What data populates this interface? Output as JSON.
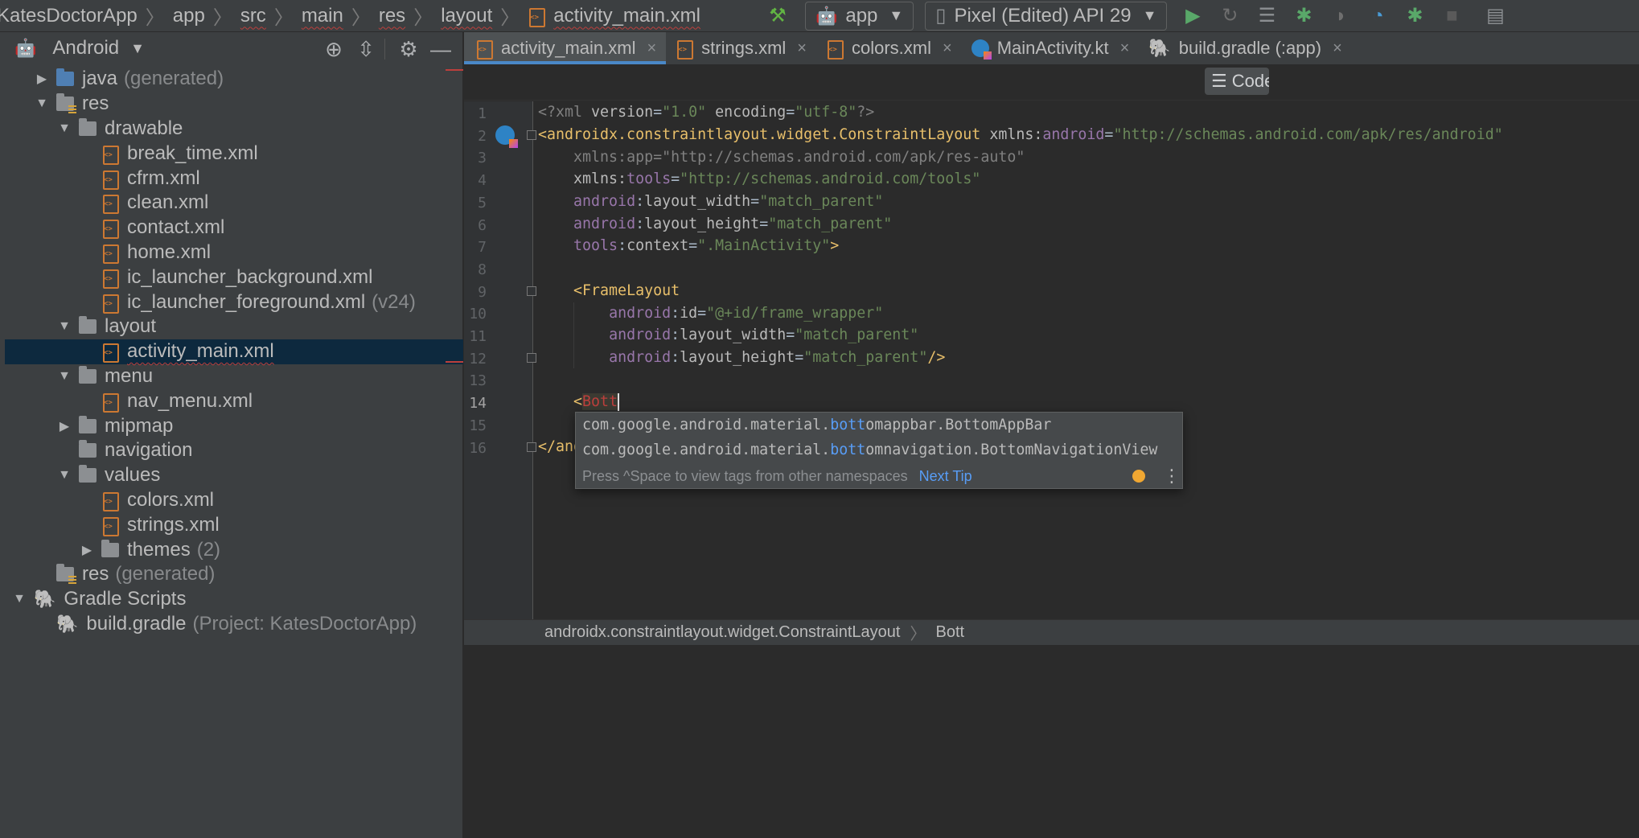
{
  "breadcrumb": {
    "items": [
      "KatesDoctorApp",
      "app",
      "src",
      "main",
      "res",
      "layout",
      "activity_main.xml"
    ]
  },
  "toolbar": {
    "run_config": "app",
    "device": "Pixel (Edited) API 29",
    "icons": [
      "hammer-icon",
      "run-icon",
      "rerun-icon",
      "coverage-icon",
      "debug-icon",
      "profile-icon",
      "speed-icon",
      "attach-debugger-icon",
      "stop-icon",
      "project-structure-icon"
    ]
  },
  "project_panel": {
    "view": "Android",
    "tree": [
      {
        "label": "java",
        "hint": "(generated)",
        "depth": 1,
        "kind": "java",
        "arrow": "collapsed"
      },
      {
        "label": "res",
        "hint": "",
        "depth": 1,
        "kind": "res",
        "arrow": "expanded"
      },
      {
        "label": "drawable",
        "hint": "",
        "depth": 2,
        "kind": "folder",
        "arrow": "expanded"
      },
      {
        "label": "break_time.xml",
        "hint": "",
        "depth": 3,
        "kind": "xml",
        "arrow": "none"
      },
      {
        "label": "cfrm.xml",
        "hint": "",
        "depth": 3,
        "kind": "xml",
        "arrow": "none"
      },
      {
        "label": "clean.xml",
        "hint": "",
        "depth": 3,
        "kind": "xml",
        "arrow": "none"
      },
      {
        "label": "contact.xml",
        "hint": "",
        "depth": 3,
        "kind": "xml",
        "arrow": "none"
      },
      {
        "label": "home.xml",
        "hint": "",
        "depth": 3,
        "kind": "xml",
        "arrow": "none"
      },
      {
        "label": "ic_launcher_background.xml",
        "hint": "",
        "depth": 3,
        "kind": "xml",
        "arrow": "none"
      },
      {
        "label": "ic_launcher_foreground.xml",
        "hint": "(v24)",
        "depth": 3,
        "kind": "xml",
        "arrow": "none"
      },
      {
        "label": "layout",
        "hint": "",
        "depth": 2,
        "kind": "folder",
        "arrow": "expanded"
      },
      {
        "label": "activity_main.xml",
        "hint": "",
        "depth": 3,
        "kind": "xml",
        "arrow": "none",
        "selected": true
      },
      {
        "label": "menu",
        "hint": "",
        "depth": 2,
        "kind": "folder",
        "arrow": "expanded"
      },
      {
        "label": "nav_menu.xml",
        "hint": "",
        "depth": 3,
        "kind": "xml",
        "arrow": "none"
      },
      {
        "label": "mipmap",
        "hint": "",
        "depth": 2,
        "kind": "folder",
        "arrow": "collapsed"
      },
      {
        "label": "navigation",
        "hint": "",
        "depth": 2,
        "kind": "folder",
        "arrow": "none"
      },
      {
        "label": "values",
        "hint": "",
        "depth": 2,
        "kind": "folder",
        "arrow": "expanded"
      },
      {
        "label": "colors.xml",
        "hint": "",
        "depth": 3,
        "kind": "xml",
        "arrow": "none"
      },
      {
        "label": "strings.xml",
        "hint": "",
        "depth": 3,
        "kind": "xml",
        "arrow": "none"
      },
      {
        "label": "themes",
        "hint": "(2)",
        "depth": 3,
        "kind": "folder",
        "arrow": "collapsed"
      },
      {
        "label": "res",
        "hint": "(generated)",
        "depth": 1,
        "kind": "res",
        "arrow": "none"
      },
      {
        "label": "Gradle Scripts",
        "hint": "",
        "depth": 0,
        "kind": "gradle",
        "arrow": "expanded"
      },
      {
        "label": "build.gradle",
        "hint": "(Project: KatesDoctorApp)",
        "depth": 1,
        "kind": "gradle",
        "arrow": "none"
      }
    ]
  },
  "tabs": [
    {
      "label": "activity_main.xml",
      "icon": "xml-icon",
      "active": true
    },
    {
      "label": "strings.xml",
      "icon": "xml-icon",
      "active": false
    },
    {
      "label": "colors.xml",
      "icon": "xml-icon",
      "active": false
    },
    {
      "label": "MainActivity.kt",
      "icon": "kotlin-icon",
      "active": false
    },
    {
      "label": "build.gradle (:app)",
      "icon": "gradle-icon",
      "active": false
    }
  ],
  "editor": {
    "view_mode_button": "Code",
    "current_line": 14,
    "line_numbers": [
      "1",
      "2",
      "3",
      "4",
      "5",
      "6",
      "7",
      "8",
      "9",
      "10",
      "11",
      "12",
      "13",
      "14",
      "15",
      "16"
    ]
  },
  "completion": {
    "items": [
      {
        "prefix": "com.google.android.material.",
        "match": "bott",
        "rest": "omappbar.BottomAppBar"
      },
      {
        "prefix": "com.google.android.material.",
        "match": "bott",
        "rest": "omnavigation.BottomNavigationView"
      }
    ],
    "hint": "Press ^Space to view tags from other namespaces",
    "next_tip": "Next Tip"
  },
  "editor_breadcrumb": {
    "items": [
      "androidx.constraintlayout.widget.ConstraintLayout",
      "Bott"
    ]
  }
}
